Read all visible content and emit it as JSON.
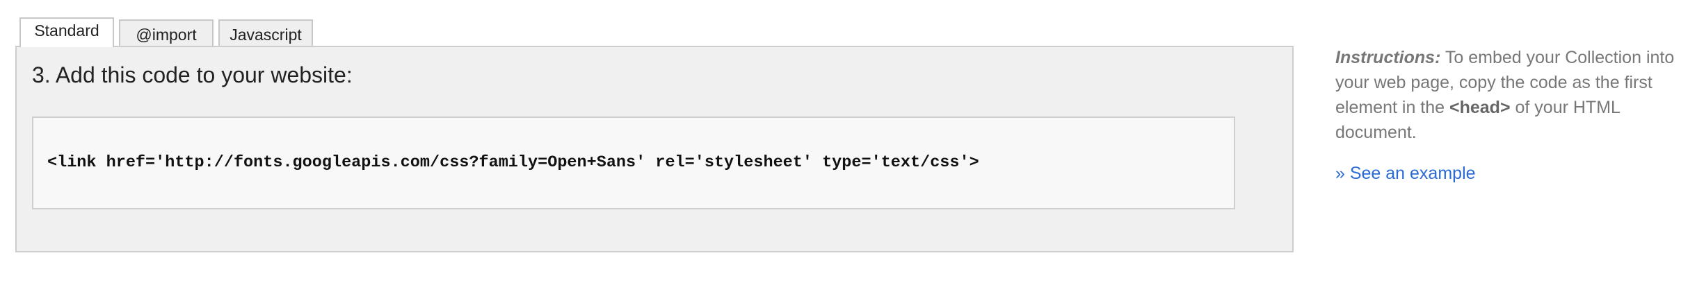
{
  "tabs": [
    {
      "label": "Standard",
      "active": true
    },
    {
      "label": "@import",
      "active": false
    },
    {
      "label": "Javascript",
      "active": false
    }
  ],
  "panel": {
    "title": "3. Add this code to your website:",
    "code": "<link href='http://fonts.googleapis.com/css?family=Open+Sans' rel='stylesheet' type='text/css'>"
  },
  "instructions": {
    "lead": "Instructions:",
    "text_before": " To embed your Collection into your web page, copy the code as the first element in the ",
    "tag": "<head>",
    "text_after": " of your HTML document.",
    "link": "» See an example"
  },
  "colors": {
    "panel_bg": "#f0f0f0",
    "code_bg": "#f8f8f8",
    "link": "#2a6bd6",
    "muted_text": "#777777"
  }
}
